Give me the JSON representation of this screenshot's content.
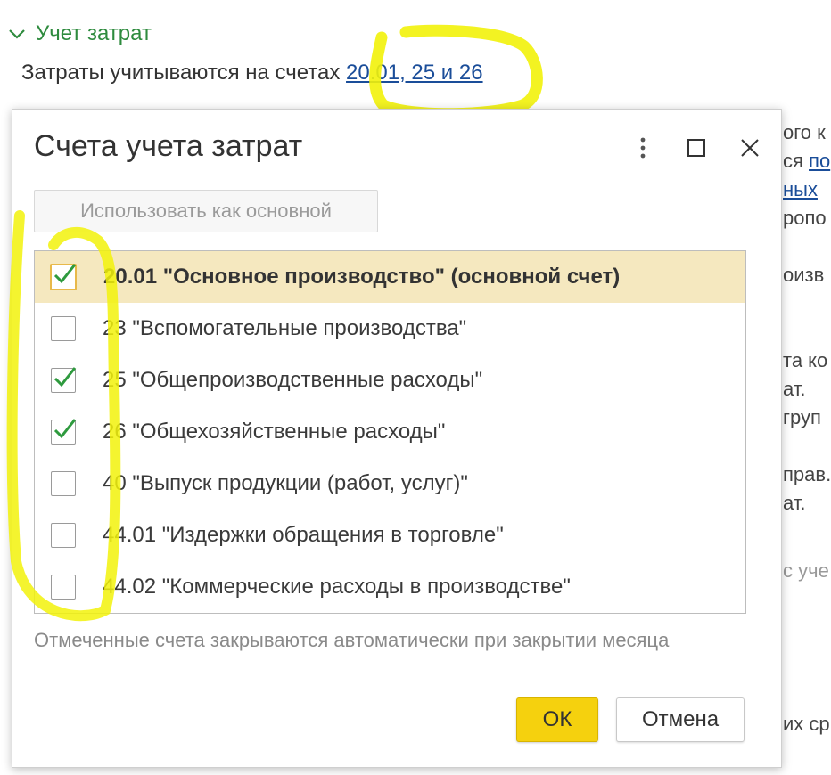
{
  "background": {
    "section_title": "Учет затрат",
    "costs_text": "Затраты учитываются на счетах ",
    "costs_link": "20.01, 25 и 26",
    "fragments": {
      "f1": "ого к",
      "f2": "ся ",
      "f2_link": "по",
      "f3_link": "ных",
      "f4": "ропо",
      "f5": "оизв",
      "f6": "та ко",
      "f7": "ат.",
      "f8": "груп",
      "f9": "прав.",
      "f10": "ат.",
      "f11": "с уче",
      "f12": "их ср"
    }
  },
  "dialog": {
    "title": "Счета учета затрат",
    "menu_icon": "more-vertical-icon",
    "maximize_icon": "maximize-icon",
    "close_icon": "close-icon",
    "use_main_button": "Использовать как основной",
    "accounts": [
      {
        "label": "20.01 \"Основное производство\" (основной счет)",
        "checked": true,
        "selected": true
      },
      {
        "label": "23 \"Вспомогательные производства\"",
        "checked": false,
        "selected": false
      },
      {
        "label": "25 \"Общепроизводственные расходы\"",
        "checked": true,
        "selected": false
      },
      {
        "label": "26 \"Общехозяйственные расходы\"",
        "checked": true,
        "selected": false
      },
      {
        "label": "40 \"Выпуск продукции (работ, услуг)\"",
        "checked": false,
        "selected": false
      },
      {
        "label": "44.01 \"Издержки обращения в торговле\"",
        "checked": false,
        "selected": false
      },
      {
        "label": "44.02 \"Коммерческие расходы в производстве\"",
        "checked": false,
        "selected": false
      }
    ],
    "footnote": "Отмеченные счета закрываются автоматически при закрытии месяца",
    "ok_label": "ОК",
    "cancel_label": "Отмена"
  },
  "colors": {
    "accent_yellow": "#f5d10e",
    "selected_row": "#f5e8bf",
    "check_green": "#2e9a3e",
    "link_blue": "#1a4d99",
    "highlighter": "#f2f20a"
  }
}
